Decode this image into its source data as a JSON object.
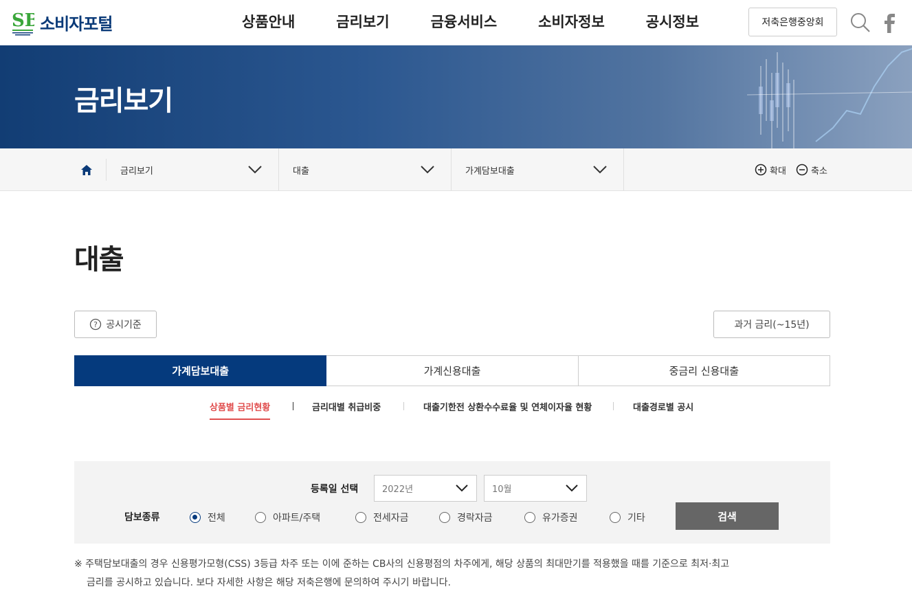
{
  "header": {
    "logo_mark": "SB",
    "logo_text": "소비자포털",
    "nav": [
      "상품안내",
      "금리보기",
      "금융서비스",
      "소비자정보",
      "공시정보"
    ],
    "assoc_button": "저축은행중앙회"
  },
  "hero": {
    "title": "금리보기"
  },
  "location": {
    "items": [
      "금리보기",
      "대출",
      "가계담보대출"
    ],
    "zoom_in": "확대",
    "zoom_out": "축소"
  },
  "page": {
    "title": "대출",
    "standard_button": "공시기준",
    "past_button": "과거 금리(~15년)"
  },
  "tabs": [
    {
      "label": "가계담보대출",
      "active": true
    },
    {
      "label": "가계신용대출",
      "active": false
    },
    {
      "label": "중금리 신용대출",
      "active": false
    }
  ],
  "subtabs": [
    {
      "label": "상품별 금리현황",
      "active": true
    },
    {
      "label": "금리대별 취급비중",
      "active": false
    },
    {
      "label": "대출기한전 상환수수료율 및 연체이자율 현황",
      "active": false
    },
    {
      "label": "대출경로별 공시",
      "active": false
    }
  ],
  "search": {
    "date_label": "등록일 선택",
    "year_value": "2022년",
    "month_value": "10월",
    "type_label": "담보종류",
    "options": [
      "전체",
      "아파트/주택",
      "전세자금",
      "경락자금",
      "유가증권",
      "기타"
    ],
    "selected": "전체",
    "button": "검색"
  },
  "note": {
    "line1": "※ 주택담보대출의 경우 신용평가모형(CSS) 3등급 차주 또는 이에 준하는 CB사의 신용평점의 차주에게, 해당 상품의 최대만기를 적용했을 때를 기준으로 최저·최고",
    "line2": "금리를 공시하고 있습니다. 보다 자세한 사항은 해당 저축은행에 문의하여 주시기 바랍니다."
  },
  "colors": {
    "brand": "#053a7d",
    "active_subtab": "#e04d4d",
    "search_button": "#666666",
    "logo_green": "#3aa63a"
  }
}
